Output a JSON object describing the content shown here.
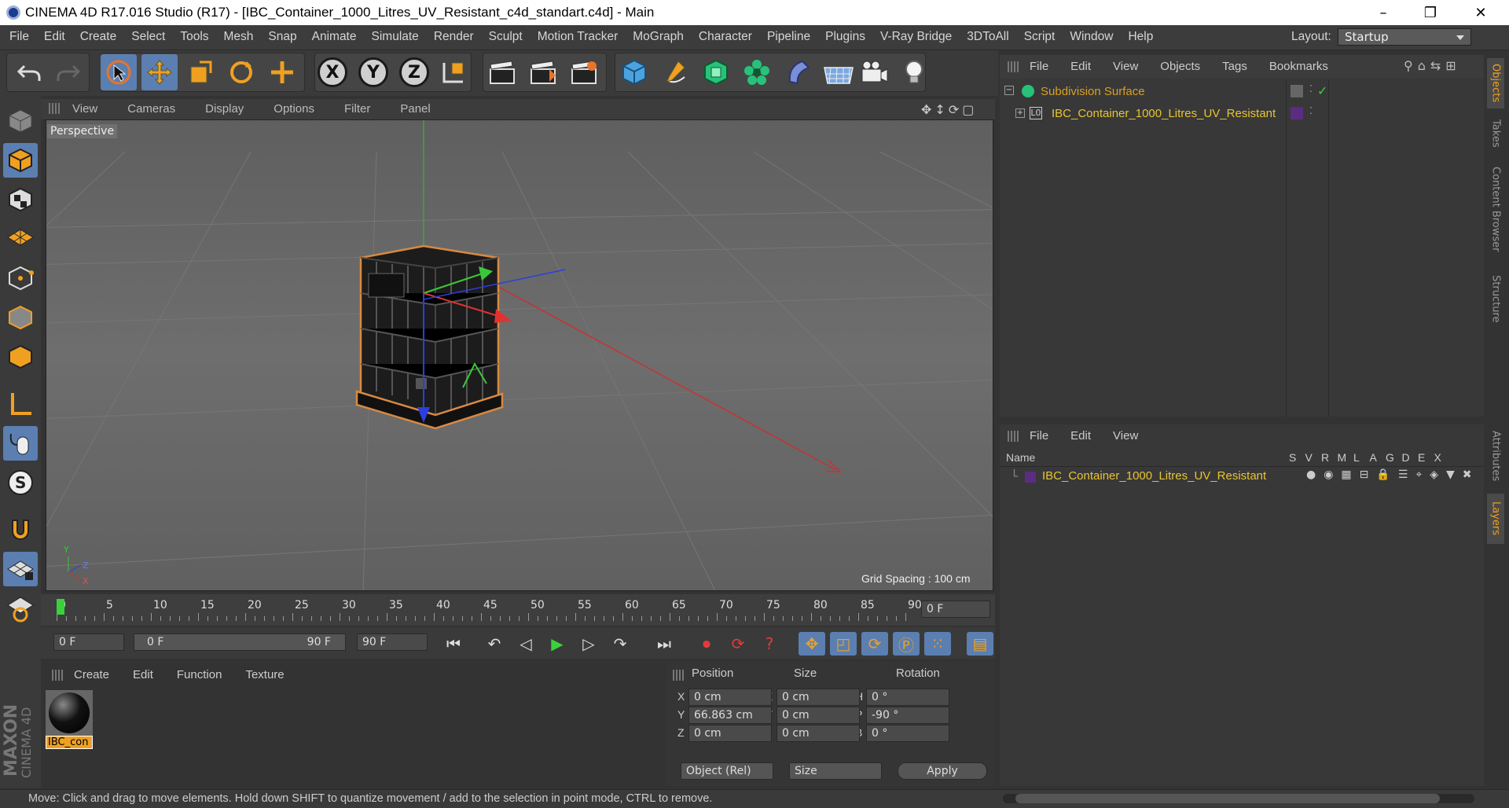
{
  "window": {
    "title": "CINEMA 4D R17.016 Studio (R17) - [IBC_Container_1000_Litres_UV_Resistant_c4d_standart.c4d] - Main",
    "minimize": "–",
    "restore": "❐",
    "close": "✕"
  },
  "menu": [
    "File",
    "Edit",
    "Create",
    "Select",
    "Tools",
    "Mesh",
    "Snap",
    "Animate",
    "Simulate",
    "Render",
    "Sculpt",
    "Motion Tracker",
    "MoGraph",
    "Character",
    "Pipeline",
    "Plugins",
    "V-Ray Bridge",
    "3DToAll",
    "Script",
    "Window",
    "Help"
  ],
  "layout": {
    "label": "Layout:",
    "value": "Startup"
  },
  "toolbar_axes": [
    "X",
    "Y",
    "Z"
  ],
  "viewport": {
    "menu": [
      "View",
      "Cameras",
      "Display",
      "Options",
      "Filter",
      "Panel"
    ],
    "label": "Perspective",
    "grid_spacing": "Grid Spacing : 100 cm",
    "axis_y": "Y",
    "axis_z": "Z",
    "axis_x": "X"
  },
  "timeline": {
    "ticks": [
      "0",
      "5",
      "10",
      "15",
      "20",
      "25",
      "30",
      "35",
      "40",
      "45",
      "50",
      "55",
      "60",
      "65",
      "70",
      "75",
      "80",
      "85",
      "90"
    ],
    "current_frame": "0 F"
  },
  "playbar": {
    "start": "0 F",
    "range_start": "0 F",
    "range_end": "90 F",
    "end": "90 F"
  },
  "material": {
    "menu": [
      "Create",
      "Edit",
      "Function",
      "Texture"
    ],
    "items": [
      {
        "name": "IBC_con"
      }
    ]
  },
  "coords": {
    "headers": [
      "Position",
      "Size",
      "Rotation"
    ],
    "rows": [
      {
        "pl": "X",
        "pv": "0 cm",
        "sl": "X",
        "sv": "0 cm",
        "rl": "H",
        "rv": "0 °"
      },
      {
        "pl": "Y",
        "pv": "66.863 cm",
        "sl": "Y",
        "sv": "0 cm",
        "rl": "P",
        "rv": "-90 °"
      },
      {
        "pl": "Z",
        "pv": "0 cm",
        "sl": "Z",
        "sv": "0 cm",
        "rl": "B",
        "rv": "0 °"
      }
    ],
    "mode": "Object (Rel)",
    "size_mode": "Size",
    "apply": "Apply"
  },
  "objects": {
    "menu": [
      "File",
      "Edit",
      "View",
      "Objects",
      "Tags",
      "Bookmarks"
    ],
    "tree": [
      {
        "name": "Subdivision Surface",
        "color": "#d9a020"
      },
      {
        "name": "IBC_Container_1000_Litres_UV_Resistant",
        "color": "#e8c430"
      }
    ]
  },
  "layers": {
    "menu": [
      "File",
      "Edit",
      "View"
    ],
    "name_header": "Name",
    "cols": [
      "S",
      "V",
      "R",
      "M",
      "L",
      "A",
      "G",
      "D",
      "E",
      "X"
    ],
    "items": [
      {
        "name": "IBC_Container_1000_Litres_UV_Resistant",
        "color": "#e8c430",
        "swatch": "#5a2d82"
      }
    ]
  },
  "side_tabs": [
    "Objects",
    "Takes",
    "Content Browser",
    "Structure",
    "Attributes",
    "Layers"
  ],
  "brand": {
    "maxon": "MAXON",
    "cinema": "CINEMA 4D"
  },
  "status": "Move: Click and drag to move elements. Hold down SHIFT to quantize movement / add to the selection in point mode, CTRL to remove.",
  "colors": {
    "accent": "#5b7fb0",
    "selection": "#d9a020"
  }
}
